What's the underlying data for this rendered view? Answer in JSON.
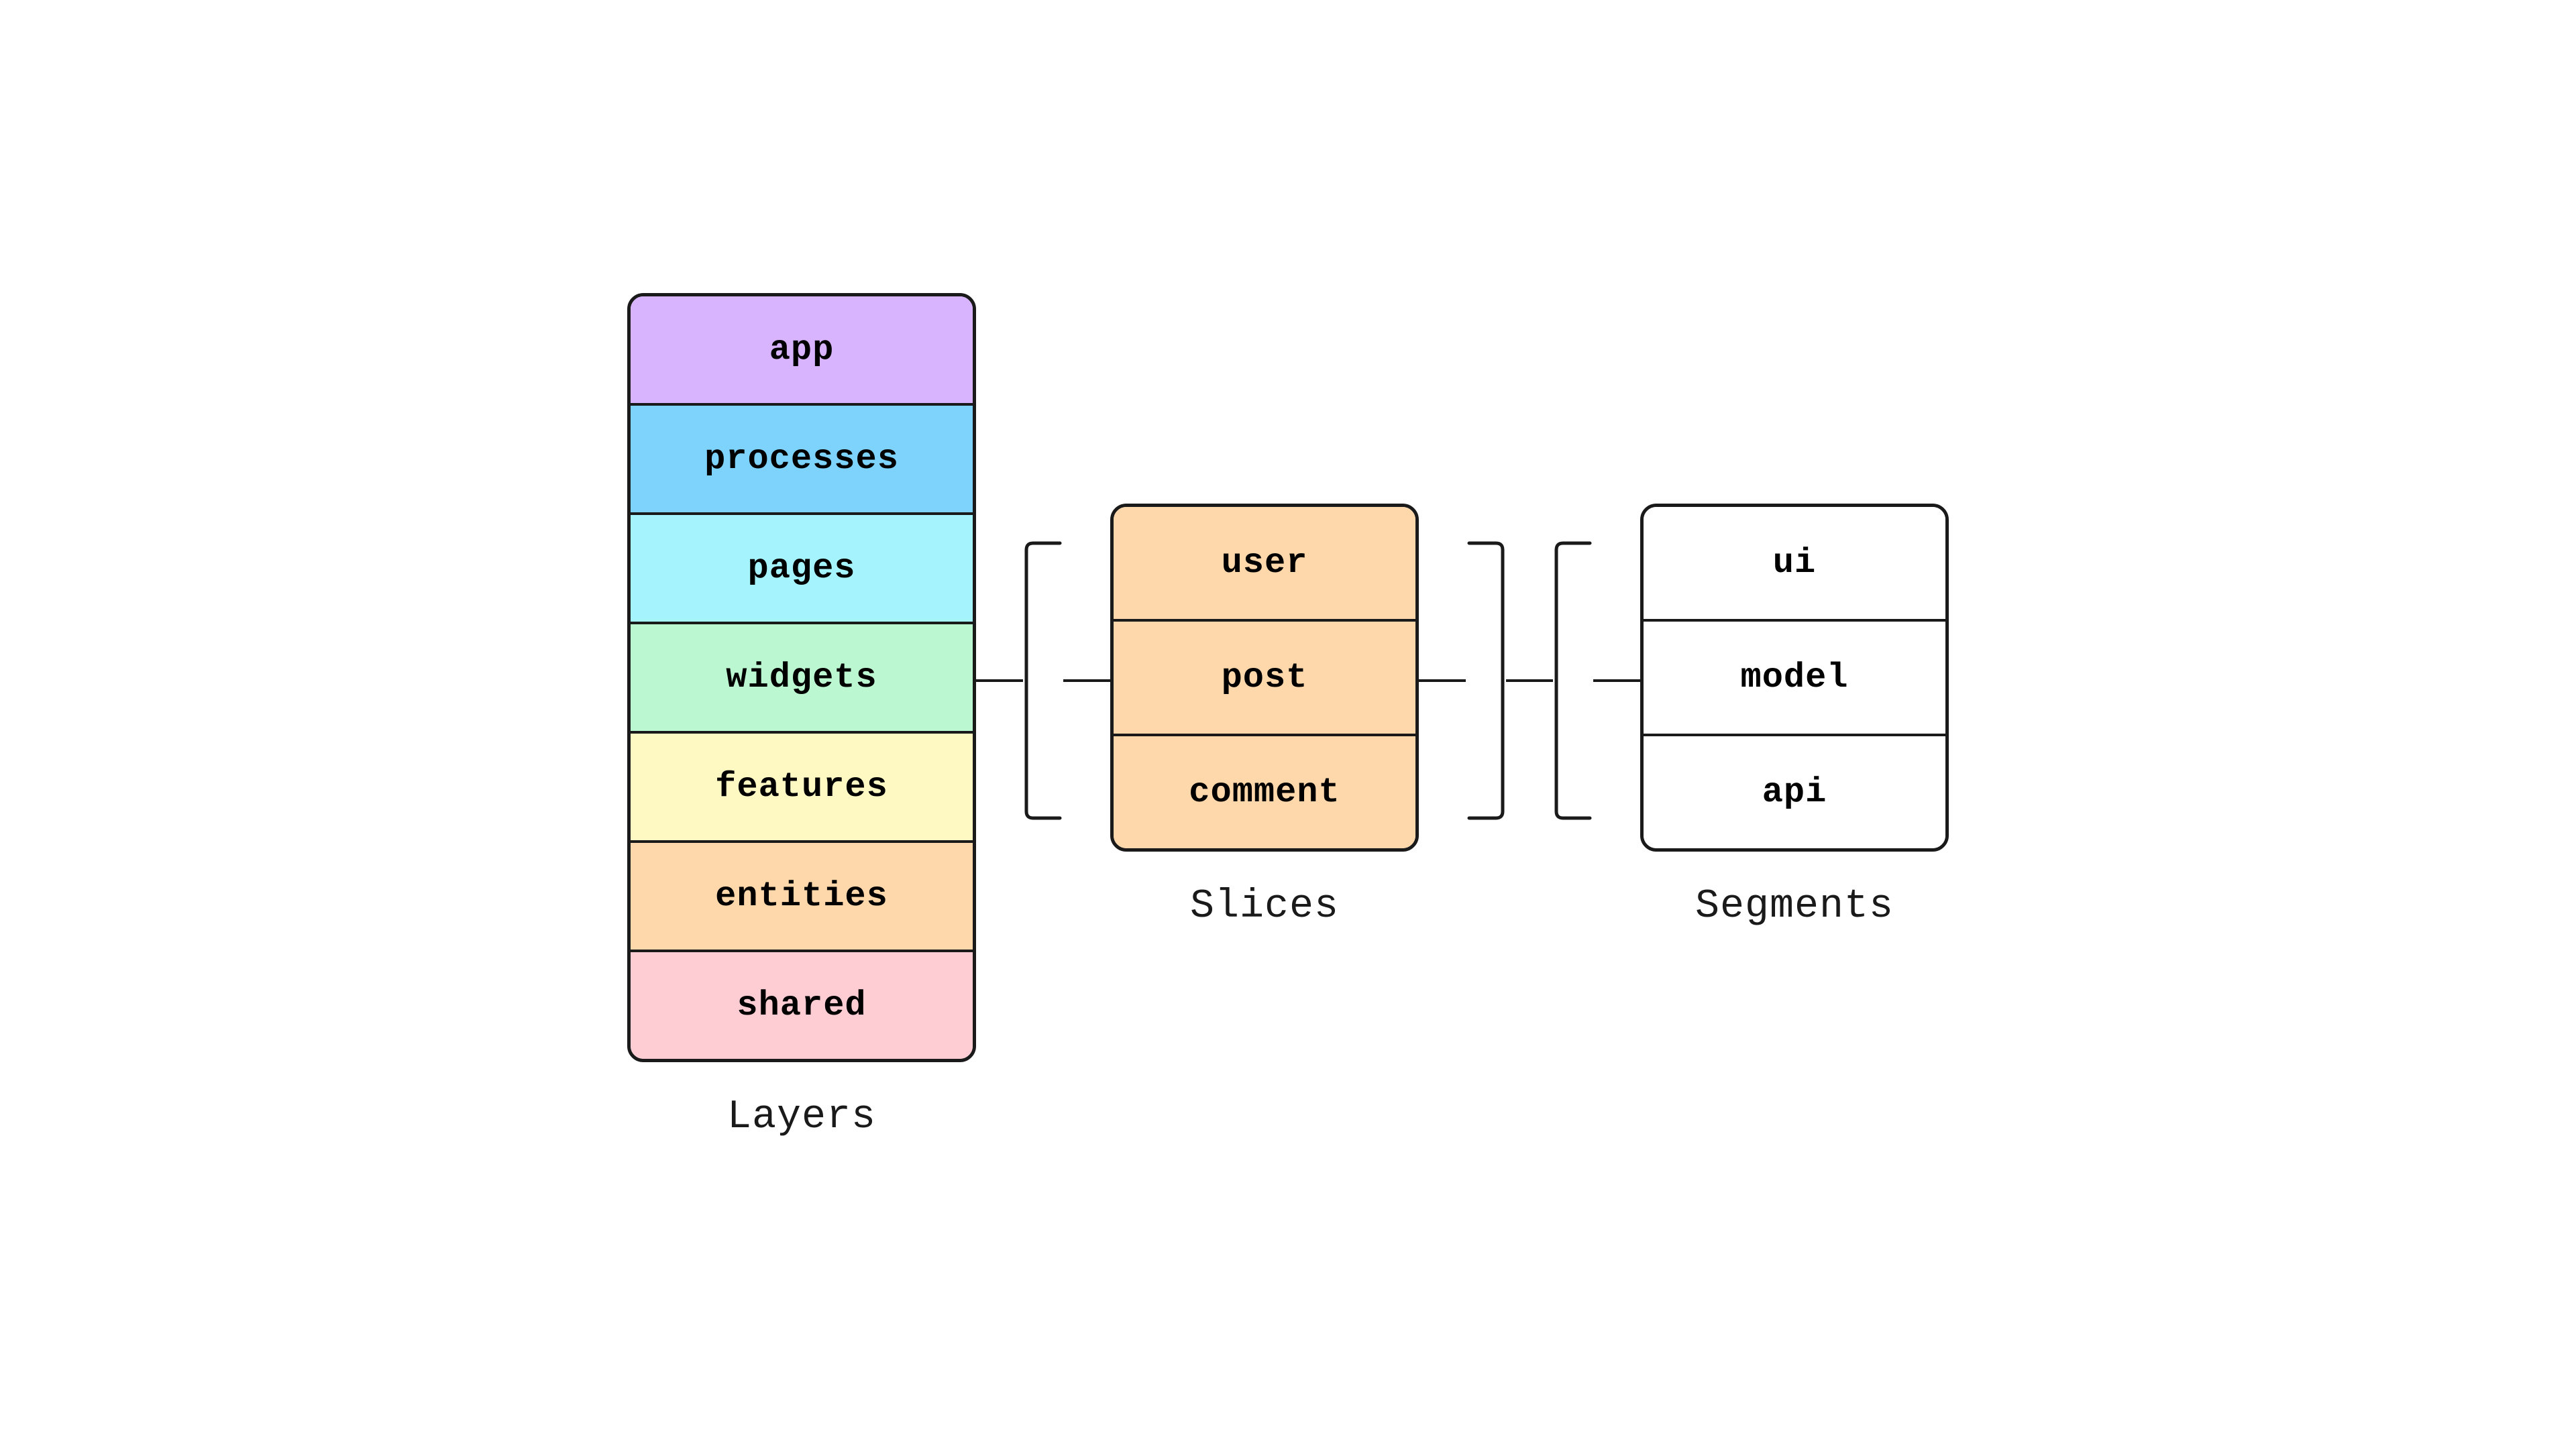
{
  "layers": {
    "label": "Layers",
    "items": [
      {
        "id": "app",
        "text": "app",
        "color": "#d8b4fe"
      },
      {
        "id": "processes",
        "text": "processes",
        "color": "#7dd3fc"
      },
      {
        "id": "pages",
        "text": "pages",
        "color": "#a5f3fc"
      },
      {
        "id": "widgets",
        "text": "widgets",
        "color": "#bbf7d0"
      },
      {
        "id": "features",
        "text": "features",
        "color": "#fef9c3"
      },
      {
        "id": "entities",
        "text": "entities",
        "color": "#fed7aa"
      },
      {
        "id": "shared",
        "text": "shared",
        "color": "#fecdd3"
      }
    ]
  },
  "slices": {
    "label": "Slices",
    "items": [
      {
        "id": "user",
        "text": "user"
      },
      {
        "id": "post",
        "text": "post"
      },
      {
        "id": "comment",
        "text": "comment"
      }
    ]
  },
  "segments": {
    "label": "Segments",
    "items": [
      {
        "id": "ui",
        "text": "ui"
      },
      {
        "id": "model",
        "text": "model"
      },
      {
        "id": "api",
        "text": "api"
      }
    ]
  },
  "connectors": {
    "line_color": "#1a1a1a"
  }
}
